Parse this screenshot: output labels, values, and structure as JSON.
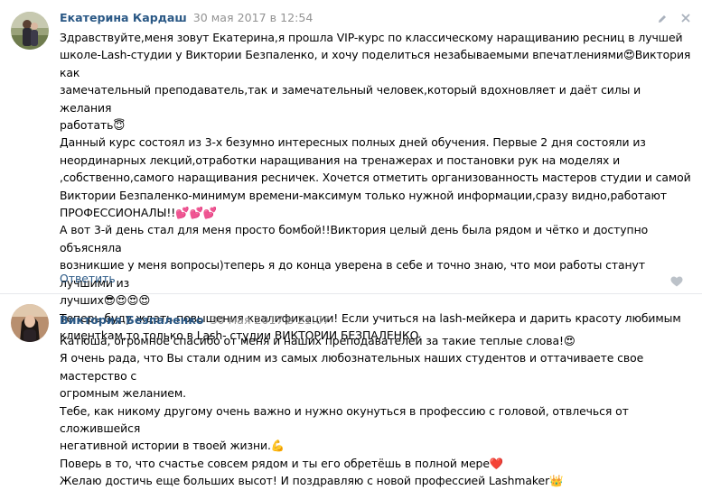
{
  "comments": [
    {
      "author": "Екатерина Кардаш",
      "date": "30 мая 2017 в 12:54",
      "text": "Здравствуйте,меня зовут Екатерина,я прошла VIP-курс по классическому наращиванию ресниц в лучшей\nшколе-Lash-студии у Виктории Безпаленко, и хочу поделиться незабываемыми впечатлениями😍Виктория как\nзамечательный преподаватель,так и замечательный человек,который вдохновляет и даёт силы и желания\nработать😇\nДанный курс состоял из 3-х безумно интересных полных дней обучения. Первые 2 дня состояли из\nнеординарных лекций,отработки наращивания на тренажерах и постановки рук на моделях и\n,собственно,самого наращивания ресничек. Хочется отметить организованность мастеров студии и самой\nВиктории Безпаленко-минимум времени-максимум только нужной информации,сразу видно,работают\nПРОФЕССИОНАЛЫ!!💕💕💕\nА вот 3-й день стал для меня просто бомбой!!Виктория целый день была рядом и чётко и доступно объясняла\nвозникшие у меня вопросы)теперь я до конца уверена в себе и точно знаю, что мои работы станут лучшими из\nлучших😎😍😍😍\nТеперь буду ждать повышения квалификации! Если учиться на lash-мейкера и дарить красоту любимым\nклиентkам,то только в Lash- студии ВИКТОРИИ БЕЗПАЛЕНКО",
      "reply_label": "Ответить"
    },
    {
      "author": "Виктория Безпаленко",
      "date": "30 мая 2017 в 21:07",
      "text": "Катюша, огромное спасибо от меня и наших преподавателей за такие теплые слова!😍\nЯ очень рада, что Вы стали одним из самых любознательных наших студентов и оттачиваете свое мастерство с\nогромным желанием.\nТебе, как никому другому очень важно и нужно окунуться в профессию с головой, отвлечься от сложившейся\nнегативной истории в твоей жизни.💪\nПоверь в то, что счастье совсем рядом и ты его обретёшь в полной мере❤️\nЖелаю достичь еще больших высот! И поздравляю с новой профессией Lashmaker👑"
    }
  ],
  "icons": {
    "edit": "pencil-icon",
    "delete": "close-icon",
    "like": "heart-icon"
  }
}
